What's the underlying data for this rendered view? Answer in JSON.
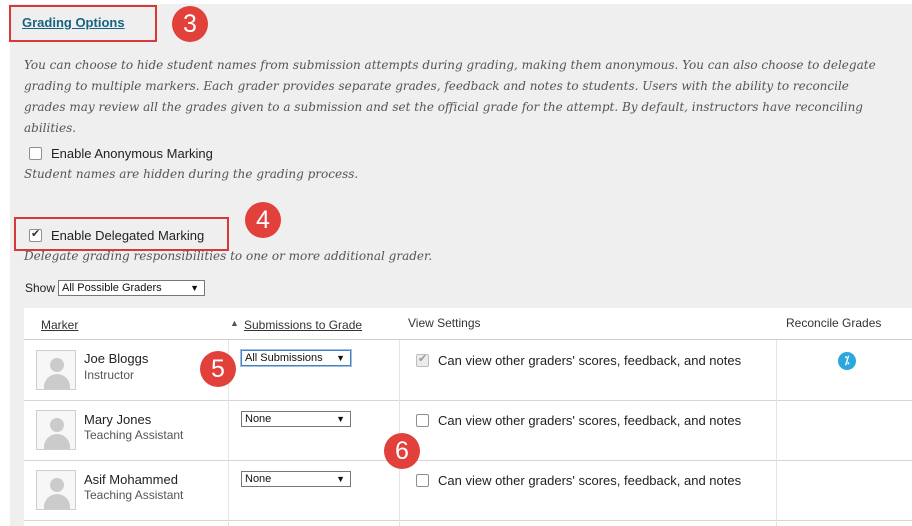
{
  "section": {
    "title": "Grading Options",
    "description": "You can choose to hide student names from submission attempts during grading, making them anonymous. You can also choose to delegate grading to multiple markers. Each grader provides separate grades, feedback and notes to students. Users with the ability to reconcile grades may review all the grades given to a submission and set the official grade for the attempt. By default, instructors have reconciling abilities."
  },
  "callouts": [
    "3",
    "4",
    "5",
    "6"
  ],
  "anonymous": {
    "label": "Enable Anonymous Marking",
    "checked": false,
    "hint": "Student names are hidden during the grading process."
  },
  "delegated": {
    "label": "Enable Delegated Marking",
    "checked": true,
    "hint": "Delegate grading responsibilities to one or more additional grader."
  },
  "show": {
    "label": "Show",
    "value": "All Possible Graders"
  },
  "table": {
    "headers": {
      "marker": "Marker",
      "submissions": "Submissions to Grade",
      "view": "View Settings",
      "reconcile": "Reconcile Grades"
    },
    "sort_icon": "sort-ascending-icon",
    "rows": [
      {
        "name": "Joe Bloggs",
        "role": "Instructor",
        "submissions": "All Submissions",
        "view_label": "Can view other graders' scores, feedback, and notes",
        "view_checked": true,
        "view_disabled": true,
        "reconcile": true,
        "reconcile_icon": "reconcile-icon"
      },
      {
        "name": "Mary Jones",
        "role": "Teaching Assistant",
        "submissions": "None",
        "view_label": "Can view other graders' scores, feedback, and notes",
        "view_checked": false,
        "view_disabled": false,
        "reconcile": false
      },
      {
        "name": "Asif Mohammed",
        "role": "Teaching Assistant",
        "submissions": "None",
        "view_label": "Can view other graders' scores, feedback, and notes",
        "view_checked": false,
        "view_disabled": false,
        "reconcile": false
      }
    ]
  },
  "colors": {
    "panel": "#efefef",
    "link": "#166481",
    "callout": "#e2403a",
    "highlight_box": "#d9383a",
    "reconcile_icon": "#2aa7de"
  }
}
